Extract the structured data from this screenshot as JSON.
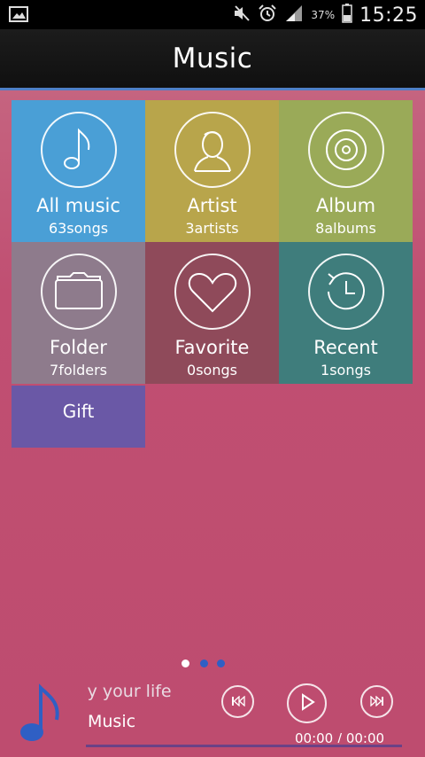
{
  "status_bar": {
    "battery": "37%",
    "time": "15:25",
    "icons": [
      "image-icon",
      "mute-icon",
      "alarm-icon",
      "signal-icon",
      "battery-icon"
    ]
  },
  "header": {
    "title": "Music"
  },
  "tiles": [
    {
      "label": "All music",
      "sub": "63songs",
      "color": "#4a9fd6",
      "icon": "music-note-icon"
    },
    {
      "label": "Artist",
      "sub": "3artists",
      "color": "#b8a54b",
      "icon": "person-icon"
    },
    {
      "label": "Album",
      "sub": "8albums",
      "color": "#9aaa58",
      "icon": "disc-icon"
    },
    {
      "label": "Folder",
      "sub": "7folders",
      "color": "#8e7b8c",
      "icon": "folder-icon"
    },
    {
      "label": "Favorite",
      "sub": "0songs",
      "color": "#8f4a5a",
      "icon": "heart-icon"
    },
    {
      "label": "Recent",
      "sub": "1songs",
      "color": "#3f7d7c",
      "icon": "history-icon"
    }
  ],
  "gift": {
    "label": "Gift",
    "color": "#6a58a6"
  },
  "pager": {
    "pages": 3,
    "current": 1
  },
  "player": {
    "title": "oy your life",
    "artist": "Music",
    "time": "00:00 / 00:00",
    "progress": 0,
    "icons": [
      "music-note-icon",
      "previous-icon",
      "play-icon",
      "next-icon"
    ],
    "accent": "#3a5fcf"
  }
}
